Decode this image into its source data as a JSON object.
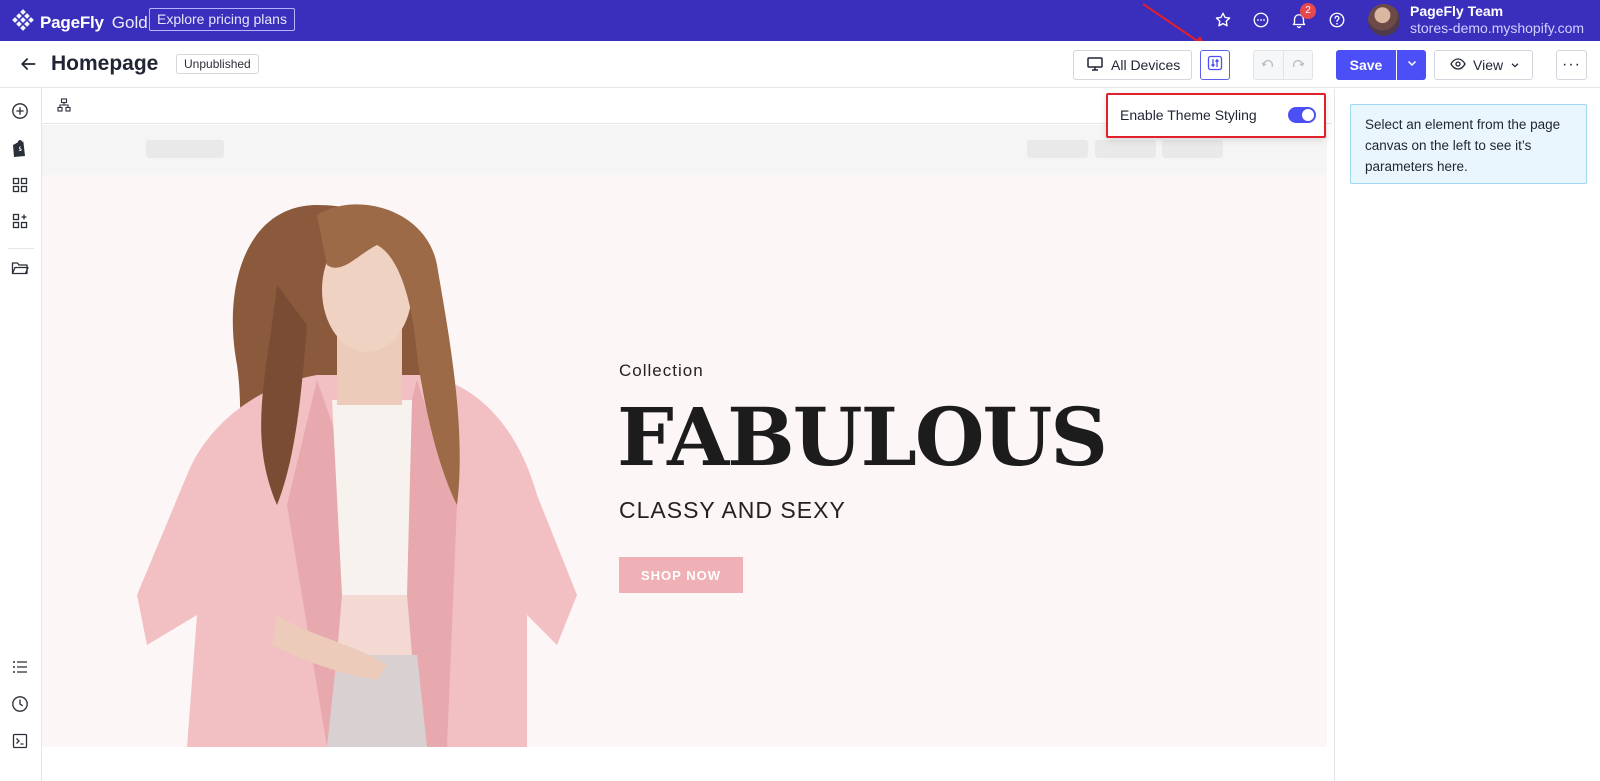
{
  "brand": {
    "name": "PageFly",
    "tier": "Gold",
    "pricing_label": "Explore pricing plans"
  },
  "notifications": {
    "count": "2"
  },
  "user": {
    "name": "PageFly Team",
    "store": "stores-demo.myshopify.com"
  },
  "page": {
    "title": "Homepage",
    "status": "Unpublished"
  },
  "toolbar": {
    "devices_label": "All Devices",
    "save_label": "Save",
    "view_label": "View",
    "more_label": "···"
  },
  "theme_popover": {
    "label": "Enable Theme Styling",
    "enabled": true
  },
  "right_panel": {
    "info_text": "Select an element from the page canvas on the left to see it’s parameters here."
  },
  "hero": {
    "eyebrow": "Collection",
    "title": "FABULOUS",
    "subtitle": "CLASSY AND SEXY",
    "cta_label": "SHOP NOW"
  },
  "colors": {
    "topbar": "#3a2fbd",
    "accent": "#4b4ff5",
    "cta": "#efb1b6",
    "highlight": "#e0202a",
    "hero_bg": "#fdf6f6"
  },
  "icons": [
    "pagefly-logo-icon",
    "star-icon",
    "chat-icon",
    "bell-icon",
    "help-icon",
    "back-arrow-icon",
    "desktop-icon",
    "theme-settings-icon",
    "undo-icon",
    "redo-icon",
    "chevron-down-icon",
    "eye-icon",
    "add-element-icon",
    "shopify-icon",
    "templates-icon",
    "sections-icon",
    "folder-icon",
    "outline-list-icon",
    "history-icon",
    "terminal-icon",
    "layer-tree-icon"
  ]
}
